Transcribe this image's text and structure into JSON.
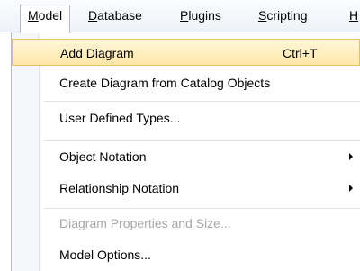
{
  "menubar": {
    "items": [
      {
        "mnemonic": "M",
        "rest": "odel"
      },
      {
        "mnemonic": "D",
        "rest": "atabase"
      },
      {
        "mnemonic": "P",
        "rest": "lugins"
      },
      {
        "mnemonic": "S",
        "rest": "cripting"
      },
      {
        "mnemonic": "H",
        "rest": ""
      }
    ]
  },
  "menu": {
    "items": [
      {
        "label": "Add Diagram",
        "shortcut": "Ctrl+T"
      },
      {
        "label": "Create Diagram from Catalog Objects"
      },
      {
        "label": "User Defined Types..."
      },
      {
        "label": "Object Notation"
      },
      {
        "label": "Relationship Notation"
      },
      {
        "label": "Diagram Properties and Size..."
      },
      {
        "label": "Model Options..."
      }
    ]
  }
}
